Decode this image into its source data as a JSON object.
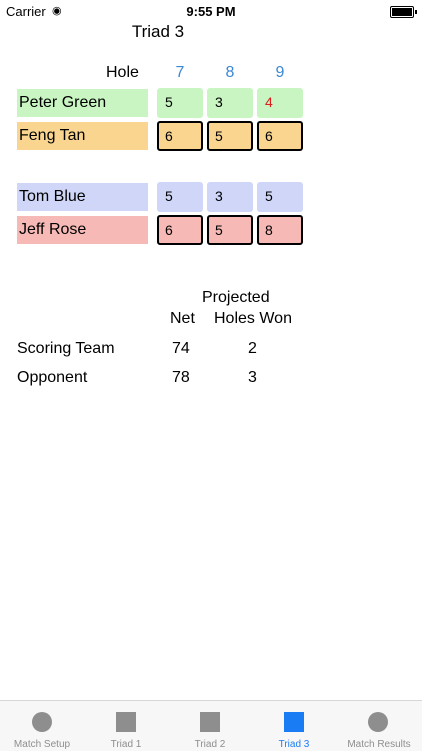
{
  "status_bar": {
    "carrier": "Carrier",
    "time": "9:55 PM"
  },
  "title": "Triad 3",
  "holes": {
    "label": "Hole",
    "numbers": [
      "7",
      "8",
      "9"
    ]
  },
  "players": [
    {
      "name": "Peter Green",
      "scores": [
        "5",
        "3",
        "4"
      ]
    },
    {
      "name": "Feng Tan",
      "scores": [
        "6",
        "5",
        "6"
      ]
    },
    {
      "name": "Tom Blue",
      "scores": [
        "5",
        "3",
        "5"
      ]
    },
    {
      "name": "Jeff Rose",
      "scores": [
        "6",
        "5",
        "8"
      ]
    }
  ],
  "summary": {
    "header_projected": "Projected",
    "header_net": "Net",
    "header_holes_won": "Holes Won",
    "rows": [
      {
        "label": "Scoring Team",
        "net": "74",
        "holes_won": "2"
      },
      {
        "label": "Opponent",
        "net": "78",
        "holes_won": "3"
      }
    ]
  },
  "tabs": [
    {
      "label": "Match Setup",
      "icon": "circle-icon"
    },
    {
      "label": "Triad 1",
      "icon": "square-icon"
    },
    {
      "label": "Triad 2",
      "icon": "square-icon"
    },
    {
      "label": "Triad 3",
      "icon": "square-icon",
      "active": true
    },
    {
      "label": "Match Results",
      "icon": "circle-icon"
    }
  ],
  "colors": {
    "accent": "#1a7cf5",
    "hole_number": "#3b87d6",
    "team1_green": "#c8f5c2",
    "team1_orange": "#f9d58f",
    "team2_blue": "#cfd6f7",
    "team2_red": "#f6b9b6",
    "highlight_score": "#e01b1b"
  }
}
